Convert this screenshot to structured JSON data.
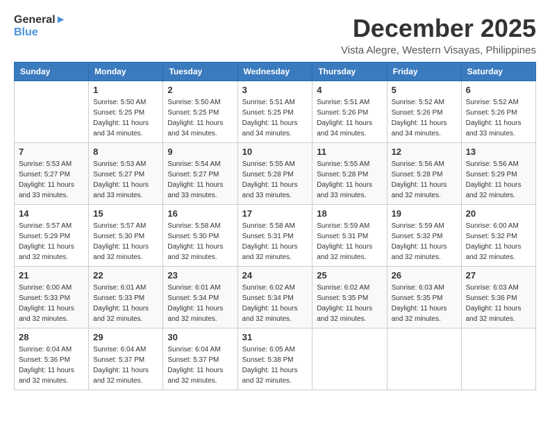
{
  "header": {
    "logo_line1": "General",
    "logo_line2": "Blue",
    "month": "December 2025",
    "location": "Vista Alegre, Western Visayas, Philippines"
  },
  "weekdays": [
    "Sunday",
    "Monday",
    "Tuesday",
    "Wednesday",
    "Thursday",
    "Friday",
    "Saturday"
  ],
  "weeks": [
    [
      {
        "day": "",
        "sunrise": "",
        "sunset": "",
        "daylight": ""
      },
      {
        "day": "1",
        "sunrise": "Sunrise: 5:50 AM",
        "sunset": "Sunset: 5:25 PM",
        "daylight": "Daylight: 11 hours and 34 minutes."
      },
      {
        "day": "2",
        "sunrise": "Sunrise: 5:50 AM",
        "sunset": "Sunset: 5:25 PM",
        "daylight": "Daylight: 11 hours and 34 minutes."
      },
      {
        "day": "3",
        "sunrise": "Sunrise: 5:51 AM",
        "sunset": "Sunset: 5:25 PM",
        "daylight": "Daylight: 11 hours and 34 minutes."
      },
      {
        "day": "4",
        "sunrise": "Sunrise: 5:51 AM",
        "sunset": "Sunset: 5:26 PM",
        "daylight": "Daylight: 11 hours and 34 minutes."
      },
      {
        "day": "5",
        "sunrise": "Sunrise: 5:52 AM",
        "sunset": "Sunset: 5:26 PM",
        "daylight": "Daylight: 11 hours and 34 minutes."
      },
      {
        "day": "6",
        "sunrise": "Sunrise: 5:52 AM",
        "sunset": "Sunset: 5:26 PM",
        "daylight": "Daylight: 11 hours and 33 minutes."
      }
    ],
    [
      {
        "day": "7",
        "sunrise": "Sunrise: 5:53 AM",
        "sunset": "Sunset: 5:27 PM",
        "daylight": "Daylight: 11 hours and 33 minutes."
      },
      {
        "day": "8",
        "sunrise": "Sunrise: 5:53 AM",
        "sunset": "Sunset: 5:27 PM",
        "daylight": "Daylight: 11 hours and 33 minutes."
      },
      {
        "day": "9",
        "sunrise": "Sunrise: 5:54 AM",
        "sunset": "Sunset: 5:27 PM",
        "daylight": "Daylight: 11 hours and 33 minutes."
      },
      {
        "day": "10",
        "sunrise": "Sunrise: 5:55 AM",
        "sunset": "Sunset: 5:28 PM",
        "daylight": "Daylight: 11 hours and 33 minutes."
      },
      {
        "day": "11",
        "sunrise": "Sunrise: 5:55 AM",
        "sunset": "Sunset: 5:28 PM",
        "daylight": "Daylight: 11 hours and 33 minutes."
      },
      {
        "day": "12",
        "sunrise": "Sunrise: 5:56 AM",
        "sunset": "Sunset: 5:28 PM",
        "daylight": "Daylight: 11 hours and 32 minutes."
      },
      {
        "day": "13",
        "sunrise": "Sunrise: 5:56 AM",
        "sunset": "Sunset: 5:29 PM",
        "daylight": "Daylight: 11 hours and 32 minutes."
      }
    ],
    [
      {
        "day": "14",
        "sunrise": "Sunrise: 5:57 AM",
        "sunset": "Sunset: 5:29 PM",
        "daylight": "Daylight: 11 hours and 32 minutes."
      },
      {
        "day": "15",
        "sunrise": "Sunrise: 5:57 AM",
        "sunset": "Sunset: 5:30 PM",
        "daylight": "Daylight: 11 hours and 32 minutes."
      },
      {
        "day": "16",
        "sunrise": "Sunrise: 5:58 AM",
        "sunset": "Sunset: 5:30 PM",
        "daylight": "Daylight: 11 hours and 32 minutes."
      },
      {
        "day": "17",
        "sunrise": "Sunrise: 5:58 AM",
        "sunset": "Sunset: 5:31 PM",
        "daylight": "Daylight: 11 hours and 32 minutes."
      },
      {
        "day": "18",
        "sunrise": "Sunrise: 5:59 AM",
        "sunset": "Sunset: 5:31 PM",
        "daylight": "Daylight: 11 hours and 32 minutes."
      },
      {
        "day": "19",
        "sunrise": "Sunrise: 5:59 AM",
        "sunset": "Sunset: 5:32 PM",
        "daylight": "Daylight: 11 hours and 32 minutes."
      },
      {
        "day": "20",
        "sunrise": "Sunrise: 6:00 AM",
        "sunset": "Sunset: 5:32 PM",
        "daylight": "Daylight: 11 hours and 32 minutes."
      }
    ],
    [
      {
        "day": "21",
        "sunrise": "Sunrise: 6:00 AM",
        "sunset": "Sunset: 5:33 PM",
        "daylight": "Daylight: 11 hours and 32 minutes."
      },
      {
        "day": "22",
        "sunrise": "Sunrise: 6:01 AM",
        "sunset": "Sunset: 5:33 PM",
        "daylight": "Daylight: 11 hours and 32 minutes."
      },
      {
        "day": "23",
        "sunrise": "Sunrise: 6:01 AM",
        "sunset": "Sunset: 5:34 PM",
        "daylight": "Daylight: 11 hours and 32 minutes."
      },
      {
        "day": "24",
        "sunrise": "Sunrise: 6:02 AM",
        "sunset": "Sunset: 5:34 PM",
        "daylight": "Daylight: 11 hours and 32 minutes."
      },
      {
        "day": "25",
        "sunrise": "Sunrise: 6:02 AM",
        "sunset": "Sunset: 5:35 PM",
        "daylight": "Daylight: 11 hours and 32 minutes."
      },
      {
        "day": "26",
        "sunrise": "Sunrise: 6:03 AM",
        "sunset": "Sunset: 5:35 PM",
        "daylight": "Daylight: 11 hours and 32 minutes."
      },
      {
        "day": "27",
        "sunrise": "Sunrise: 6:03 AM",
        "sunset": "Sunset: 5:36 PM",
        "daylight": "Daylight: 11 hours and 32 minutes."
      }
    ],
    [
      {
        "day": "28",
        "sunrise": "Sunrise: 6:04 AM",
        "sunset": "Sunset: 5:36 PM",
        "daylight": "Daylight: 11 hours and 32 minutes."
      },
      {
        "day": "29",
        "sunrise": "Sunrise: 6:04 AM",
        "sunset": "Sunset: 5:37 PM",
        "daylight": "Daylight: 11 hours and 32 minutes."
      },
      {
        "day": "30",
        "sunrise": "Sunrise: 6:04 AM",
        "sunset": "Sunset: 5:37 PM",
        "daylight": "Daylight: 11 hours and 32 minutes."
      },
      {
        "day": "31",
        "sunrise": "Sunrise: 6:05 AM",
        "sunset": "Sunset: 5:38 PM",
        "daylight": "Daylight: 11 hours and 32 minutes."
      },
      {
        "day": "",
        "sunrise": "",
        "sunset": "",
        "daylight": ""
      },
      {
        "day": "",
        "sunrise": "",
        "sunset": "",
        "daylight": ""
      },
      {
        "day": "",
        "sunrise": "",
        "sunset": "",
        "daylight": ""
      }
    ]
  ]
}
